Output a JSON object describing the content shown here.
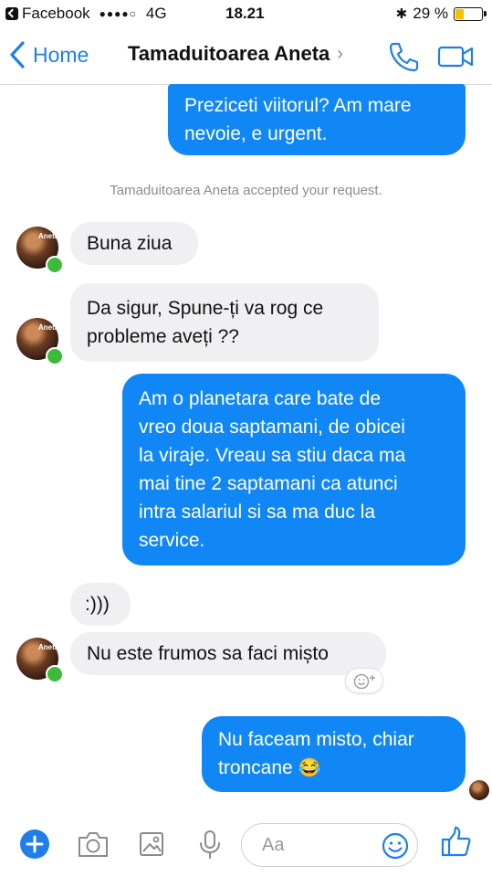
{
  "status_bar": {
    "carrier": "Facebook",
    "signal": "●●●●○",
    "network": "4G",
    "time": "18.21",
    "bluetooth": "✱",
    "battery_percent": "29 %",
    "battery_level": 0.29,
    "battery_color": "#f3c300"
  },
  "nav": {
    "back_label": "Home",
    "title": "Tamaduitoarea Aneta",
    "title_chevron": "›",
    "accent": "#1f7fe8",
    "icons": [
      "phone-icon",
      "video-camera-icon"
    ]
  },
  "messages": [
    {
      "from": "me",
      "text_lines": [
        "Preziceti viitorul? Am mare",
        "nevoie, e urgent."
      ]
    },
    {
      "type": "system",
      "text": "Tamaduitoarea Aneta accepted your request."
    },
    {
      "from": "them",
      "text_lines": [
        "Buna ziua"
      ]
    },
    {
      "from": "them",
      "text_lines": [
        "Da sigur, Spune-ți va rog ce",
        "probleme aveți ??"
      ]
    },
    {
      "from": "me",
      "text_lines": [
        "Am o planetara care bate de",
        "vreo doua saptamani, de obicei",
        "la viraje. Vreau sa stiu daca ma",
        "mai tine 2 saptamani ca atunci",
        "intra salariul si sa ma duc la",
        "service."
      ]
    },
    {
      "from": "them",
      "text_lines": [
        ":)))"
      ]
    },
    {
      "from": "them",
      "text_lines": [
        "Nu este frumos sa faci mișto"
      ]
    },
    {
      "from": "me",
      "text_lines": [
        "Nu faceam misto, chiar",
        "troncane"
      ],
      "emoji": "😂"
    }
  ],
  "avatar_label": "Aneta",
  "colors": {
    "outgoing": "#1187f5",
    "incoming": "#f0f0f2",
    "online": "#3cbb3b"
  },
  "composer": {
    "placeholder": "Aa",
    "icons": [
      "plus-icon",
      "camera-icon",
      "image-icon",
      "microphone-icon",
      "emoji-icon",
      "like-icon"
    ]
  }
}
